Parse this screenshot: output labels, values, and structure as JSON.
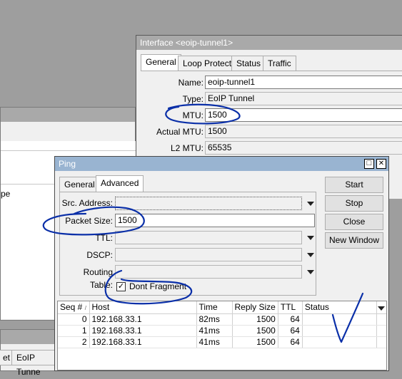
{
  "colors": {
    "desktop": "#9e9e9e",
    "title_inactive": "#a9a9a9",
    "title_active": "#99b4d1",
    "ink": "#0a2fa8"
  },
  "bg_window_left": {
    "row_label": "pe"
  },
  "bg_window_bottom": {
    "tabs": [
      "et",
      "EoIP Tunne"
    ]
  },
  "interface_window": {
    "title": "Interface <eoip-tunnel1>",
    "tabs": [
      "General",
      "Loop Protect",
      "Status",
      "Traffic"
    ],
    "fields": [
      {
        "label": "Name:",
        "value": "eoip-tunnel1"
      },
      {
        "label": "Type:",
        "value": "EoIP Tunnel"
      },
      {
        "label": "MTU:",
        "value": "1500"
      },
      {
        "label": "Actual MTU:",
        "value": "1500"
      },
      {
        "label": "L2 MTU:",
        "value": "65535"
      }
    ]
  },
  "ping_window": {
    "title": "Ping",
    "controls": {
      "maximize": "□",
      "close": "✕"
    },
    "tabs": [
      "General",
      "Advanced"
    ],
    "fields": {
      "src_address": {
        "label": "Src. Address:",
        "value": ""
      },
      "packet_size": {
        "label": "Packet Size:",
        "value": "1500"
      },
      "ttl": {
        "label": "TTL:",
        "value": ""
      },
      "dscp": {
        "label": "DSCP:",
        "value": ""
      },
      "routing_table": {
        "label": "Routing Table:",
        "value": ""
      }
    },
    "dont_fragment": {
      "label": "Dont Fragment",
      "checked": true
    },
    "buttons": [
      "Start",
      "Stop",
      "Close",
      "New Window"
    ],
    "table": {
      "headers": [
        "Seq #",
        "Host",
        "Time",
        "Reply Size",
        "TTL",
        "Status"
      ],
      "rows": [
        {
          "seq": "0",
          "host": "192.168.33.1",
          "time": "82ms",
          "size": "1500",
          "ttl": "64",
          "status": ""
        },
        {
          "seq": "1",
          "host": "192.168.33.1",
          "time": "41ms",
          "size": "1500",
          "ttl": "64",
          "status": ""
        },
        {
          "seq": "2",
          "host": "192.168.33.1",
          "time": "41ms",
          "size": "1500",
          "ttl": "64",
          "status": ""
        }
      ]
    }
  }
}
